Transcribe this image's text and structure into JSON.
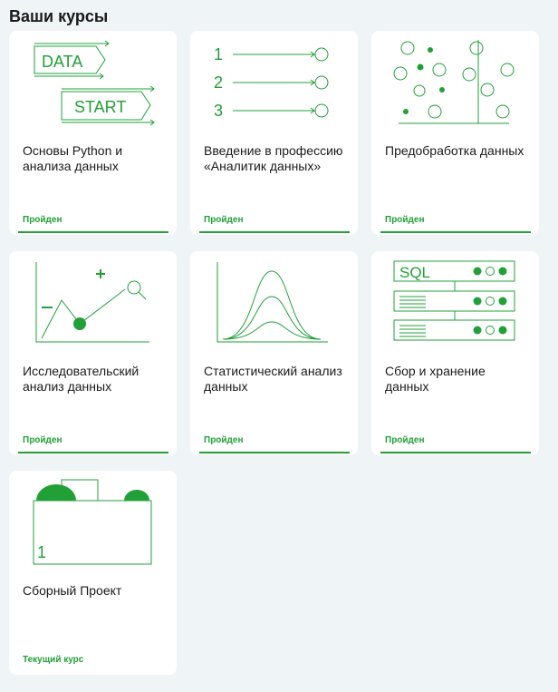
{
  "page": {
    "title": "Ваши курсы"
  },
  "courses": [
    {
      "title": "Основы Python и анализа данных",
      "status": "Пройден",
      "icon": "data-start-icon",
      "art_labels": {
        "data": "DATA",
        "start": "START"
      }
    },
    {
      "title": "Введение в профессию «Аналитик данных»",
      "status": "Пройден",
      "icon": "numbered-steps-icon",
      "art_labels": {
        "n1": "1",
        "n2": "2",
        "n3": "3"
      }
    },
    {
      "title": "Предобработка данных",
      "status": "Пройден",
      "icon": "scatter-split-icon"
    },
    {
      "title": "Исследовательский анализ данных",
      "status": "Пройден",
      "icon": "magnifier-graph-icon"
    },
    {
      "title": "Статистический анализ данных",
      "status": "Пройден",
      "icon": "bell-curves-icon"
    },
    {
      "title": "Сбор и хранение данных",
      "status": "Пройден",
      "icon": "sql-database-icon",
      "art_labels": {
        "sql": "SQL"
      }
    },
    {
      "title": "Сборный Проект",
      "status": "Текущий курс",
      "icon": "project-box-icon",
      "art_labels": {
        "n1": "1"
      }
    }
  ],
  "colors": {
    "accent": "#21a038",
    "background": "#eff4f6",
    "card": "#ffffff"
  }
}
